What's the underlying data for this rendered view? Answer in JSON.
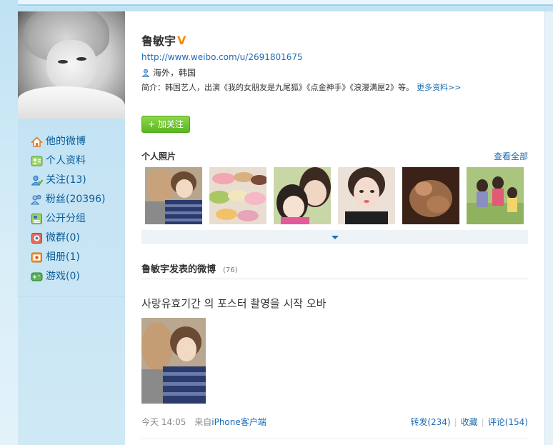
{
  "profile": {
    "name": "鲁敏宇",
    "url": "http://www.weibo.com/u/2691801675",
    "location": "海外，韩国",
    "bio_prefix": "简介：韩国艺人，出演《我的女朋友是九尾狐》《点金神手》《浪漫满屋2》等。",
    "more_label": "更多资料>>",
    "follow_label": "+ 加关注"
  },
  "sidebar": {
    "items": [
      {
        "label": "他的微博",
        "icon": "home-icon"
      },
      {
        "label": "个人资料",
        "icon": "profile-card-icon"
      },
      {
        "label": "关注(13)",
        "icon": "follow-user-icon"
      },
      {
        "label": "粉丝(20396)",
        "icon": "fans-icon"
      },
      {
        "label": "公开分组",
        "icon": "group-icon"
      },
      {
        "label": "微群(0)",
        "icon": "weiqun-icon"
      },
      {
        "label": "相册(1)",
        "icon": "album-icon"
      },
      {
        "label": "游戏(0)",
        "icon": "game-icon"
      }
    ]
  },
  "photos": {
    "title": "个人照片",
    "see_all": "查看全部",
    "count_shown": 6
  },
  "feed": {
    "title": "鲁敏宇发表的微博",
    "count": "(76)",
    "post": {
      "text": "사랑유효기간 의 포스터 촬영을 시작 오바",
      "time": "今天 14:05",
      "source_prefix": "来自",
      "source": "iPhone客户端",
      "repost": "转发(234)",
      "favorite": "收藏",
      "comment": "评论(154)"
    }
  },
  "colors": {
    "link": "#1c6cb3",
    "follow_green": "#58b81f",
    "verified_orange": "#f78800",
    "sidebar_bg": "#cfe8f5"
  }
}
